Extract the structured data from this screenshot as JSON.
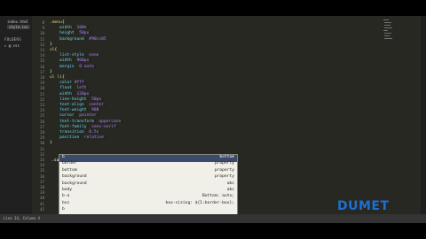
{
  "sidebar": {
    "open_files": [
      "index.html",
      "style.css"
    ],
    "folders_label": "FOLDERS",
    "folder": "css"
  },
  "code_lines": [
    {
      "n": "8",
      "html": "<span class='sel'>.menu</span><span class='brace'>{</span>"
    },
    {
      "n": "9",
      "html": "    <span class='prop'>width</span>: <span class='val'>100%</span>;"
    },
    {
      "n": "10",
      "html": "    <span class='prop'>height</span>: <span class='val'>50px</span>;"
    },
    {
      "n": "11",
      "html": "    <span class='prop'>background</span>: <span class='val'>#90cc05</span>;"
    },
    {
      "n": "12",
      "html": "<span class='brace'>}</span>"
    },
    {
      "n": "13",
      "html": "<span class='sel'>ul</span><span class='brace'>{</span>"
    },
    {
      "n": "14",
      "html": "    <span class='prop'>list-style</span>: <span class='val'>none</span>;"
    },
    {
      "n": "15",
      "html": "    <span class='prop'>width</span>: <span class='val'>960px</span>;"
    },
    {
      "n": "16",
      "html": "    <span class='prop'>margin</span>: <span class='val'>0 auto</span>;"
    },
    {
      "n": "17",
      "html": "<span class='brace'>}</span>"
    },
    {
      "n": "18",
      "html": "<span class='sel'>ul li</span><span class='brace'>{</span>"
    },
    {
      "n": "19",
      "html": "    <span class='prop'>color</span>:<span class='val'>#fff</span>;"
    },
    {
      "n": "20",
      "html": "    <span class='prop'>float</span>: <span class='val'>left</span>;"
    },
    {
      "n": "21",
      "html": "    <span class='prop'>width</span>: <span class='val'>120px</span>;"
    },
    {
      "n": "22",
      "html": "    <span class='prop'>line-height</span>: <span class='val'>50px</span>;"
    },
    {
      "n": "23",
      "html": "    <span class='prop'>text-align</span>: <span class='val'>center</span>;"
    },
    {
      "n": "24",
      "html": "    <span class='prop'>font-weight</span>: <span class='val'>900</span>;"
    },
    {
      "n": "25",
      "html": "    <span class='prop'>cursor</span>: <span class='val'>pointer</span>;"
    },
    {
      "n": "26",
      "html": "    <span class='prop'>text-transform</span>: <span class='val'>uppercase</span>;"
    },
    {
      "n": "27",
      "html": "    <span class='prop'>font-family</span>: <span class='val'>sans-serif</span>;"
    },
    {
      "n": "28",
      "html": "    <span class='prop'>transition</span>: <span class='val'>0.5s</span>;"
    },
    {
      "n": "29",
      "html": "    <span class='prop'>position</span>: <span class='val'>relative</span>;"
    },
    {
      "n": "30",
      "html": "<span class='brace'>}</span>"
    },
    {
      "n": "31",
      "html": ""
    },
    {
      "n": "32",
      "html": ""
    },
    {
      "n": "33",
      "html": ""
    },
    {
      "n": "34",
      "html": ""
    },
    {
      "n": "35",
      "html": ""
    },
    {
      "n": "36",
      "html": ""
    },
    {
      "n": "37",
      "html": ""
    },
    {
      "n": "38",
      "html": ""
    },
    {
      "n": "39",
      "html": ""
    },
    {
      "n": "40",
      "html": ""
    },
    {
      "n": "41",
      "html": ""
    },
    {
      "n": "42",
      "html": ""
    }
  ],
  "partial_input": ".sa",
  "autocomplete": [
    {
      "key": "b",
      "hint": "bottom"
    },
    {
      "key": "border",
      "hint": "property"
    },
    {
      "key": "bottom",
      "hint": "property"
    },
    {
      "key": "background",
      "hint": "property"
    },
    {
      "key": "background",
      "hint": "abc"
    },
    {
      "key": "body",
      "hint": "abc"
    },
    {
      "key": "b-a",
      "hint": "Bottom: auto;"
    },
    {
      "key": "bxz",
      "hint": "box-sizing: ${1:border-box};"
    },
    {
      "key": "b",
      "hint": ""
    }
  ],
  "status": "Line 34, Column 4",
  "watermark": "DUMET"
}
